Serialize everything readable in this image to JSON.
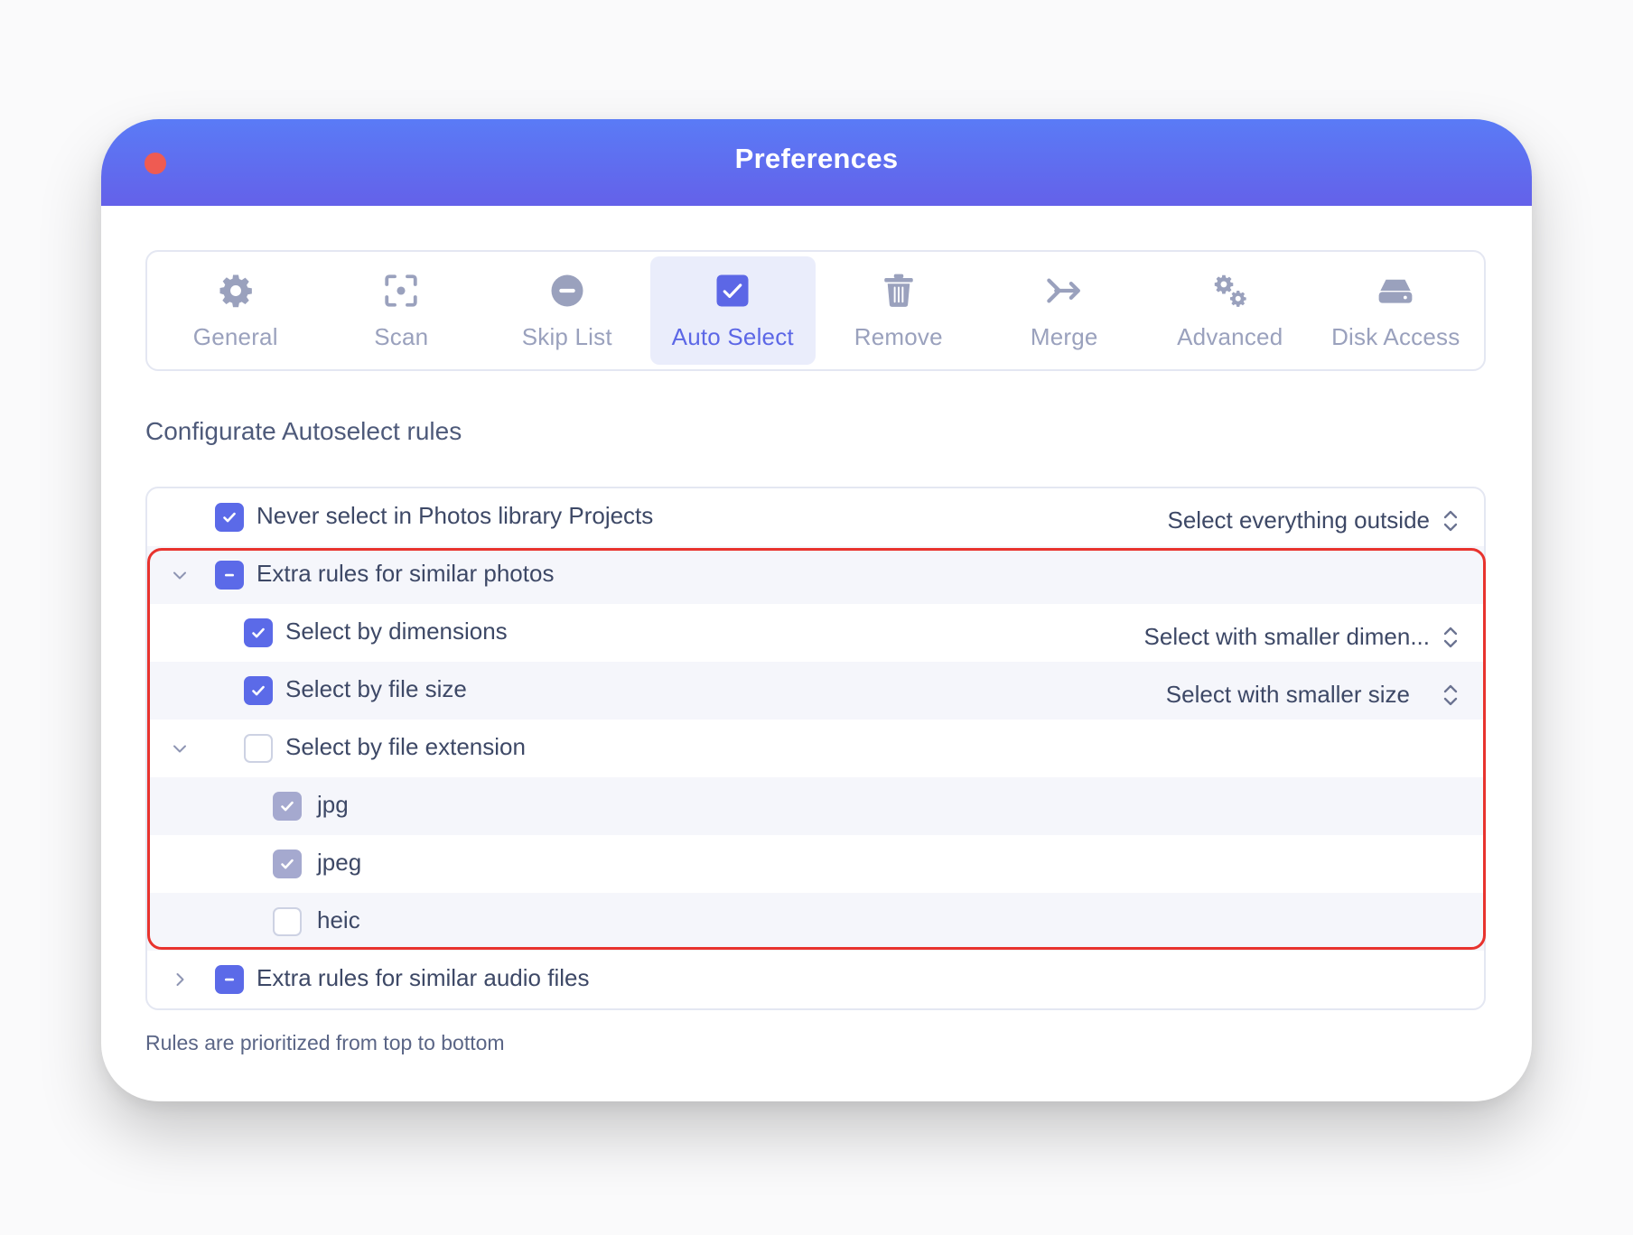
{
  "window": {
    "title": "Preferences"
  },
  "toolbar": {
    "tabs": [
      {
        "label": "General",
        "icon": "gear-icon"
      },
      {
        "label": "Scan",
        "icon": "scan-icon"
      },
      {
        "label": "Skip List",
        "icon": "minus-circle-icon"
      },
      {
        "label": "Auto Select",
        "icon": "checkbox-icon",
        "active": true
      },
      {
        "label": "Remove",
        "icon": "trash-icon"
      },
      {
        "label": "Merge",
        "icon": "merge-arrow-icon"
      },
      {
        "label": "Advanced",
        "icon": "gears-icon"
      },
      {
        "label": "Disk Access",
        "icon": "disk-icon"
      }
    ]
  },
  "main": {
    "heading": "Configurate Autoselect rules",
    "footer": "Rules are prioritized from top to bottom"
  },
  "rules": [
    {
      "label": "Never select in Photos library Projects",
      "state": "checked",
      "select": "Select everything outside"
    },
    {
      "label": "Extra rules for similar photos",
      "state": "mixed",
      "expanded": true
    },
    {
      "label": "Select by dimensions",
      "state": "checked",
      "select": "Select with smaller dimen..."
    },
    {
      "label": "Select by file size",
      "state": "checked",
      "select": "Select with smaller size"
    },
    {
      "label": "Select by file extension",
      "state": "unchecked",
      "expanded": true
    },
    {
      "label": "jpg",
      "state": "checked-disabled"
    },
    {
      "label": "jpeg",
      "state": "checked-disabled"
    },
    {
      "label": "heic",
      "state": "unchecked"
    },
    {
      "label": "Extra rules for similar audio files",
      "state": "mixed",
      "expanded": false
    }
  ],
  "colors": {
    "accent": "#5b6ae8",
    "titlebar_top": "#5a7bf6",
    "titlebar_bottom": "#6461e9",
    "highlight": "#e8332e",
    "close_button": "#ef5b52"
  }
}
